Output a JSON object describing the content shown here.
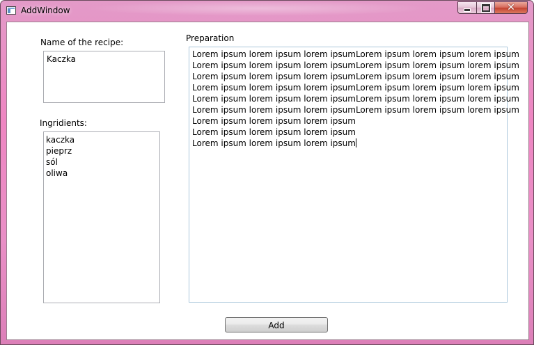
{
  "window": {
    "title": "AddWindow",
    "icons": {
      "app": "app-window-icon",
      "minimize": "minimize-icon",
      "maximize": "maximize-icon",
      "close": "close-icon"
    }
  },
  "form": {
    "name_label": "Name of the recipe:",
    "name_value": "Kaczka",
    "ingredients_label": "Ingridients:",
    "ingredients": [
      "kaczka",
      "pieprz",
      "sól",
      "oliwa"
    ],
    "preparation_label": "Preparation",
    "preparation_lines": [
      "Lorem ipsum lorem ipsum lorem ipsumLorem ipsum lorem ipsum lorem ipsum",
      "Lorem ipsum lorem ipsum lorem ipsumLorem ipsum lorem ipsum lorem ipsum",
      "Lorem ipsum lorem ipsum lorem ipsumLorem ipsum lorem ipsum lorem ipsum",
      "Lorem ipsum lorem ipsum lorem ipsumLorem ipsum lorem ipsum lorem ipsum",
      "Lorem ipsum lorem ipsum lorem ipsumLorem ipsum lorem ipsum lorem ipsum",
      "Lorem ipsum lorem ipsum lorem ipsumLorem ipsum lorem ipsum lorem ipsum",
      "Lorem ipsum lorem ipsum lorem ipsum",
      "Lorem ipsum lorem ipsum lorem ipsum",
      "Lorem ipsum lorem ipsum lorem ipsum"
    ],
    "add_button": "Add"
  }
}
